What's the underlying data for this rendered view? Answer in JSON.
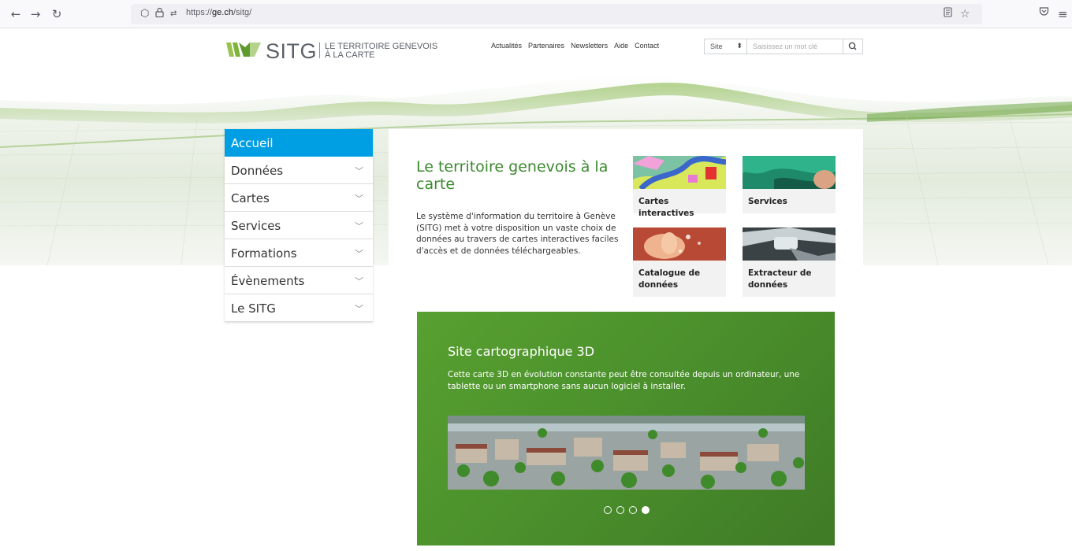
{
  "browser": {
    "url_prefix": "https://",
    "url_domain": "ge.ch",
    "url_path": "/sitg/"
  },
  "logo": {
    "wordmark": "SITG",
    "tagline_line1": "LE TERRITOIRE GENEVOIS",
    "tagline_line2": "À LA CARTE"
  },
  "topnav": {
    "items": [
      "Actualités",
      "Partenaires",
      "Newsletters",
      "Aide",
      "Contact"
    ]
  },
  "search": {
    "scope_value": "Site",
    "placeholder": "Saisissez un mot clé"
  },
  "menu": {
    "items": [
      {
        "label": "Accueil",
        "active": true
      },
      {
        "label": "Données"
      },
      {
        "label": "Cartes"
      },
      {
        "label": "Services"
      },
      {
        "label": "Formations"
      },
      {
        "label": "Évènements"
      },
      {
        "label": "Le SITG"
      }
    ]
  },
  "intro": {
    "title": "Le territoire genevois à la carte",
    "text": "Le système d'information du territoire à Genève (SITG) met à votre disposition un vaste choix de données au travers de cartes interactives faciles d'accès et de données téléchargeables."
  },
  "cards": [
    {
      "label": "Cartes interactives"
    },
    {
      "label": "Services"
    },
    {
      "label": "Catalogue de données"
    },
    {
      "label": "Extracteur de données"
    }
  ],
  "banner": {
    "title": "Site cartographique 3D",
    "text": "Cette carte 3D en évolution constante peut être consultée depuis un ordinateur, une tablette ou un smartphone sans aucun logiciel à installer.",
    "slide_count": 4,
    "active_slide": 4
  },
  "colors": {
    "accent_blue": "#009fe3",
    "title_green": "#3a8a2e",
    "banner_green": "#4a8f2c"
  }
}
